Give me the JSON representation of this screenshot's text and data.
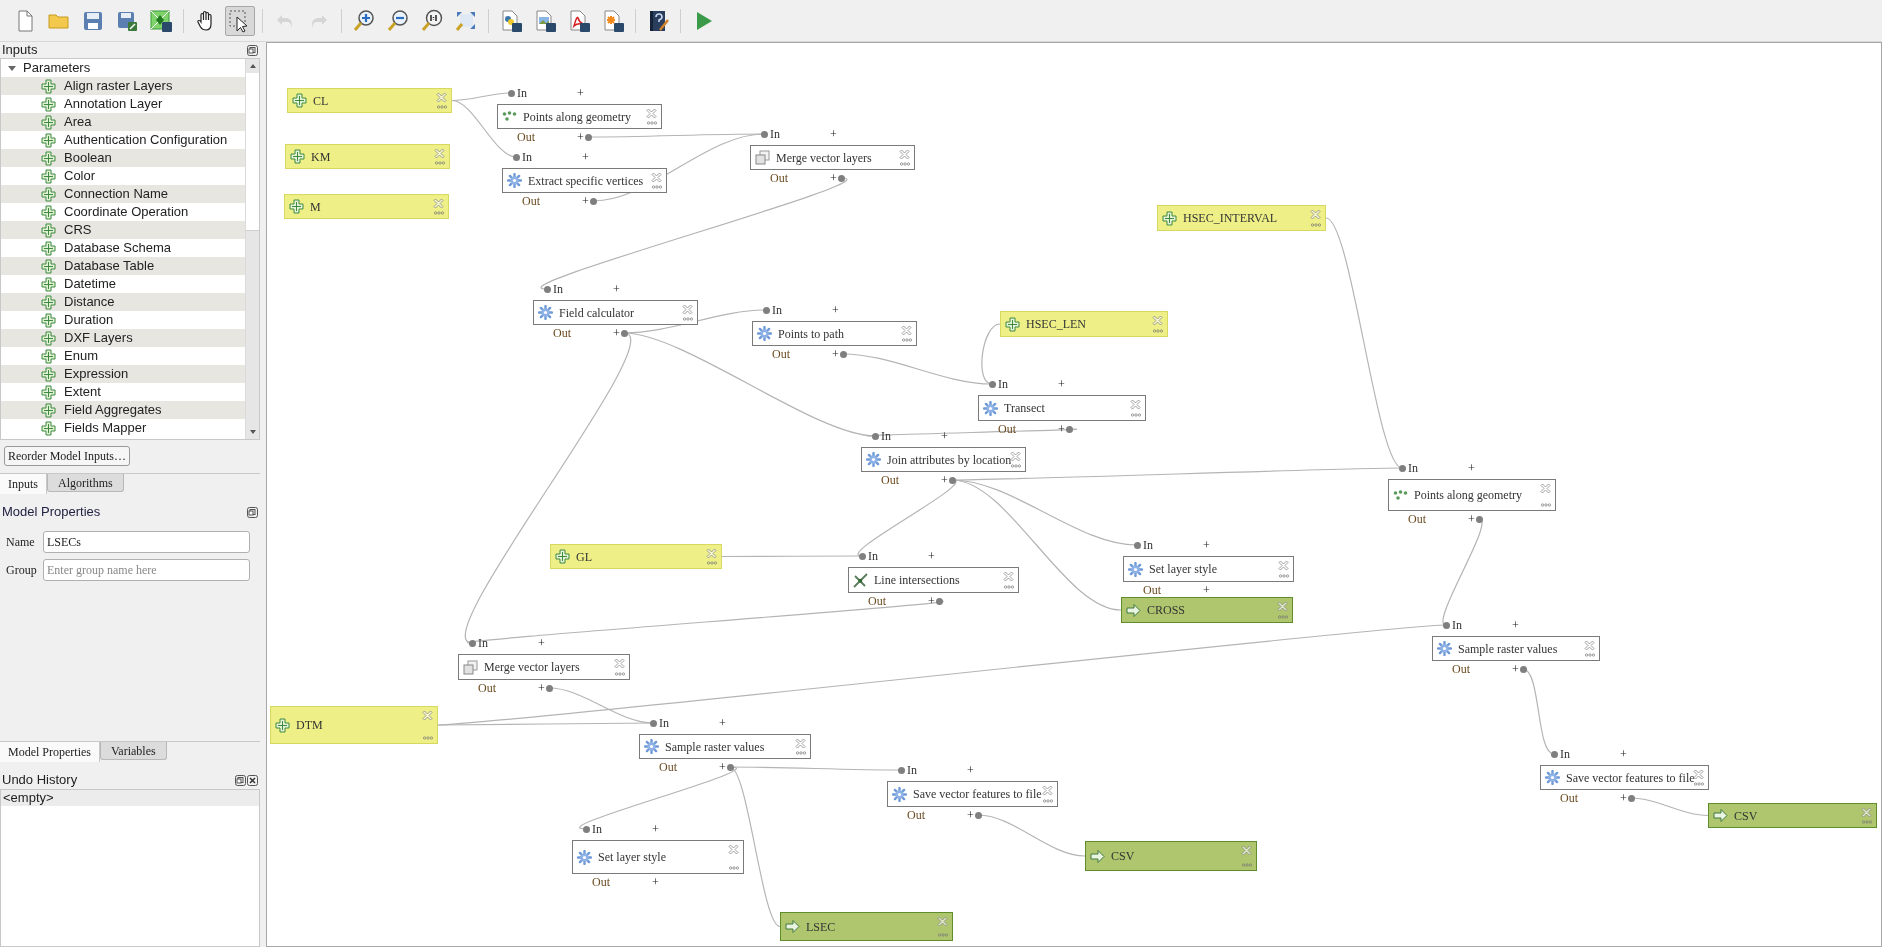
{
  "toolbar": [
    {
      "selected": false,
      "disabled": false
    },
    {
      "selected": false,
      "disabled": false
    },
    {
      "selected": false,
      "disabled": false
    },
    {
      "selected": false,
      "disabled": false
    },
    {
      "selected": false,
      "disabled": false
    },
    {
      "selected": false,
      "disabled": false
    },
    {
      "selected": true,
      "disabled": false
    },
    {
      "selected": false,
      "disabled": true
    },
    {
      "selected": false,
      "disabled": true
    },
    {
      "selected": false,
      "disabled": false
    },
    {
      "selected": false,
      "disabled": false
    },
    {
      "selected": false,
      "disabled": false
    },
    {
      "selected": false,
      "disabled": false
    },
    {
      "selected": false,
      "disabled": false
    },
    {
      "selected": false,
      "disabled": false
    },
    {
      "selected": false,
      "disabled": false
    },
    {
      "selected": false,
      "disabled": false
    },
    {
      "selected": false,
      "disabled": false
    },
    {
      "selected": false,
      "disabled": false
    }
  ],
  "inputs_panel": {
    "title": "Inputs",
    "tree": {
      "label": "Parameters",
      "expanded": true,
      "children": [
        {
          "label": "Align raster Layers"
        },
        {
          "label": "Annotation Layer"
        },
        {
          "label": "Area"
        },
        {
          "label": "Authentication Configuration"
        },
        {
          "label": "Boolean"
        },
        {
          "label": "Color"
        },
        {
          "label": "Connection Name"
        },
        {
          "label": "Coordinate Operation"
        },
        {
          "label": "CRS"
        },
        {
          "label": "Database Schema"
        },
        {
          "label": "Database Table"
        },
        {
          "label": "Datetime"
        },
        {
          "label": "Distance"
        },
        {
          "label": "Duration"
        },
        {
          "label": "DXF Layers"
        },
        {
          "label": "Enum"
        },
        {
          "label": "Expression"
        },
        {
          "label": "Extent"
        },
        {
          "label": "Field Aggregates"
        },
        {
          "label": "Fields Mapper"
        }
      ]
    }
  },
  "reorder_button": "Reorder Model Inputs…",
  "panel_tabs": [
    {
      "label": "Inputs",
      "selected": true
    },
    {
      "label": "Algorithms",
      "selected": false
    }
  ],
  "model_properties": {
    "title": "Model Properties",
    "fields": [
      {
        "label": "Name",
        "value": "LSECs"
      },
      {
        "label": "Group",
        "placeholder": "Enter group name here"
      }
    ]
  },
  "bottom_tabs": [
    {
      "label": "Model Properties",
      "selected": true
    },
    {
      "label": "Variables",
      "selected": false
    }
  ],
  "undo_history": {
    "title": "Undo History",
    "items": [
      "<empty>"
    ]
  },
  "canvas": {
    "nodes": [
      {
        "kind": "input",
        "label": "CL"
      },
      {
        "kind": "input",
        "label": "KM"
      },
      {
        "kind": "input",
        "label": "M"
      },
      {
        "kind": "algorithm",
        "label": "Points along geometry",
        "in_label": "In",
        "in_plus": "+",
        "out_label": "Out",
        "out_plus": "+"
      },
      {
        "kind": "algorithm",
        "label": "Extract specific vertices",
        "in_label": "In",
        "in_plus": "+",
        "out_label": "Out",
        "out_plus": "+"
      },
      {
        "kind": "algorithm",
        "label": "Merge vector layers",
        "in_label": "In",
        "in_plus": "+",
        "out_label": "Out",
        "out_plus": "+"
      },
      {
        "kind": "algorithm",
        "label": "Field calculator",
        "in_label": "In",
        "in_plus": "+",
        "out_label": "Out",
        "out_plus": "+"
      },
      {
        "kind": "algorithm",
        "label": "Points to path",
        "in_label": "In",
        "in_plus": "+",
        "out_label": "Out",
        "out_plus": "+"
      },
      {
        "kind": "input",
        "label": "HSEC_LEN"
      },
      {
        "kind": "algorithm",
        "label": "Transect",
        "in_label": "In",
        "in_plus": "+",
        "out_label": "Out",
        "out_plus": "+"
      },
      {
        "kind": "algorithm",
        "label": "Join attributes by location",
        "in_label": "In",
        "in_plus": "+",
        "out_label": "Out",
        "out_plus": "+"
      },
      {
        "kind": "input",
        "label": "HSEC_INTERVAL"
      },
      {
        "kind": "algorithm",
        "label": "Points along geometry",
        "in_label": "In",
        "in_plus": "+",
        "out_label": "Out",
        "out_plus": "+"
      },
      {
        "kind": "input",
        "label": "GL"
      },
      {
        "kind": "algorithm",
        "label": "Line intersections",
        "in_label": "In",
        "in_plus": "+",
        "out_label": "Out",
        "out_plus": "+"
      },
      {
        "kind": "algorithm",
        "label": "Set layer style",
        "in_label": "In",
        "in_plus": "+",
        "out_label": "Out",
        "out_plus": "+"
      },
      {
        "kind": "output",
        "label": "CROSS"
      },
      {
        "kind": "algorithm",
        "label": "Merge vector layers",
        "in_label": "In",
        "in_plus": "+",
        "out_label": "Out",
        "out_plus": "+"
      },
      {
        "kind": "input",
        "label": "DTM"
      },
      {
        "kind": "algorithm",
        "label": "Sample raster values",
        "in_label": "In",
        "in_plus": "+",
        "out_label": "Out",
        "out_plus": "+"
      },
      {
        "kind": "algorithm",
        "label": "Save vector features to file",
        "in_label": "In",
        "in_plus": "+",
        "out_label": "Out",
        "out_plus": "+"
      },
      {
        "kind": "algorithm",
        "label": "Set layer style",
        "in_label": "In",
        "in_plus": "+",
        "out_label": "Out",
        "out_plus": "+"
      },
      {
        "kind": "output",
        "label": "CSV"
      },
      {
        "kind": "output",
        "label": "LSEC"
      },
      {
        "kind": "algorithm",
        "label": "Sample raster values",
        "in_label": "In",
        "in_plus": "+",
        "out_label": "Out",
        "out_plus": "+"
      },
      {
        "kind": "algorithm",
        "label": "Save vector features to file",
        "in_label": "In",
        "in_plus": "+",
        "out_label": "Out",
        "out_plus": "+"
      },
      {
        "kind": "output",
        "label": "CSV"
      }
    ]
  }
}
